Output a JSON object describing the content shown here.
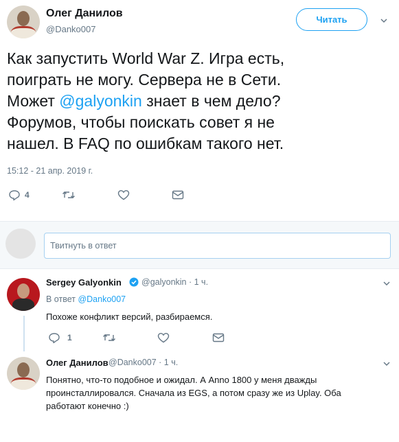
{
  "main_tweet": {
    "author_name": "Олег Данилов",
    "author_handle": "@Danko007",
    "follow_label": "Читать",
    "text_lines": [
      "Как запустить World War Z. Игра есть,",
      "поиграть не могу. Сервера не в Сети.",
      "Может ",
      "@galyonkin",
      " знает в чем дело?",
      "Форумов, чтобы поискать совет я не",
      "нашел. В FAQ по ошибкам такого нет."
    ],
    "timestamp": "15:12 - 21 апр. 2019 г.",
    "reply_count": "4"
  },
  "reply_box": {
    "placeholder": "Твитнуть в ответ"
  },
  "replies": [
    {
      "author_name": "Sergey Galyonkin",
      "author_handle": "@galyonkin",
      "time": "· 1 ч.",
      "in_reply_prefix": "В ответ ",
      "in_reply_handle": "@Danko007",
      "text": "Похоже конфликт версий, разбираемся.",
      "reply_count": "1"
    },
    {
      "author_name": "Олег Данилов",
      "author_handle": "@Danko007",
      "time": "· 1 ч.",
      "text_lines": [
        "Понятно, что-то подобное и ожидал. А Anno 1800 у меня дважды",
        "проинсталлировался. Сначала из EGS, а потом сразу же из Uplay. Оба",
        "работают конечно :)"
      ]
    }
  ],
  "icons": {
    "reply": "reply-icon",
    "retweet": "retweet-icon",
    "like": "heart-icon",
    "dm": "envelope-icon",
    "more": "chevron-down-icon",
    "verified": "verified-badge-icon"
  },
  "colors": {
    "accent": "#1da1f2",
    "secondary_text": "#657786",
    "primary_text": "#14171a"
  }
}
